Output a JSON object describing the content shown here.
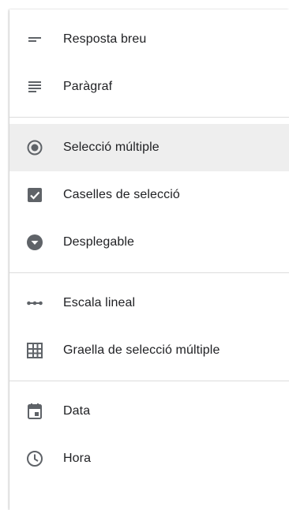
{
  "menu": {
    "groups": [
      {
        "items": [
          {
            "label": "Resposta breu",
            "icon": "short-answer-icon"
          },
          {
            "label": "Paràgraf",
            "icon": "paragraph-icon"
          }
        ]
      },
      {
        "items": [
          {
            "label": "Selecció múltiple",
            "icon": "radio-button-icon",
            "selected": true
          },
          {
            "label": "Caselles de selecció",
            "icon": "checkbox-icon"
          },
          {
            "label": "Desplegable",
            "icon": "dropdown-icon"
          }
        ]
      },
      {
        "items": [
          {
            "label": "Escala lineal",
            "icon": "linear-scale-icon"
          },
          {
            "label": "Graella de selecció múltiple",
            "icon": "grid-icon"
          }
        ]
      },
      {
        "items": [
          {
            "label": "Data",
            "icon": "calendar-icon"
          },
          {
            "label": "Hora",
            "icon": "clock-icon"
          }
        ]
      }
    ]
  },
  "colors": {
    "icon": "#5f6368",
    "text": "#202124",
    "selected_bg": "#eeeeee",
    "divider": "#dcdcdc"
  }
}
